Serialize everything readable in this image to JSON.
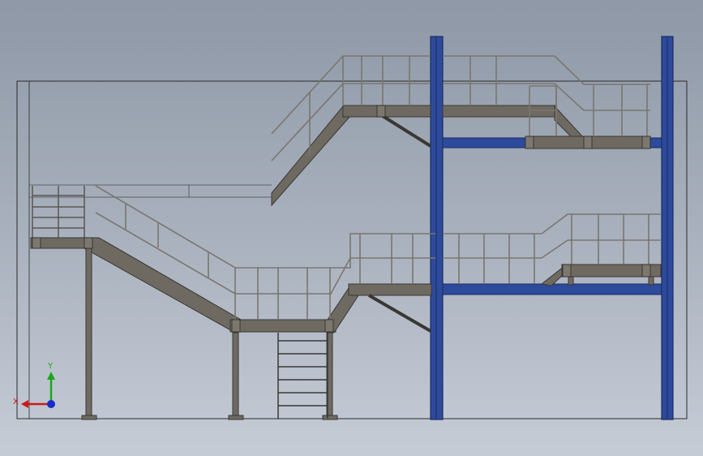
{
  "viewport": {
    "background_top": "#8e98a6",
    "background_bottom": "#c6ccd6"
  },
  "colors": {
    "steel": "#6e6a62",
    "steel_dark": "#3a3834",
    "column_blue": "#2e4a9a",
    "column_blue_dark": "#1a2c66",
    "rail": "#7a766e",
    "frame_line": "#2a2a2a"
  },
  "triad": {
    "x_label": "X",
    "y_label": "Y",
    "x_color": "#cc1a1a",
    "y_color": "#1aa81a",
    "z_color": "#1a2ccc"
  }
}
